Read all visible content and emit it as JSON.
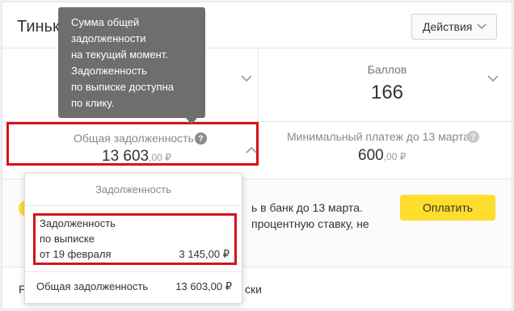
{
  "header": {
    "title": "Тинькофф Платинум",
    "actions_label": "Действия"
  },
  "points": {
    "label": "Баллов",
    "value": "166"
  },
  "debt": {
    "label": "Общая задолженность",
    "value_main": "13 603",
    "value_minor": ",00 ₽"
  },
  "min_payment": {
    "label": "Минимальный платеж до 13 марта",
    "value_main": "600",
    "value_minor": ",00 ₽"
  },
  "notice": {
    "line1": "ь в банк до 13 марта.",
    "line2": "процентную ставку, не"
  },
  "pay_button": "Оплатить",
  "bottom_row": {
    "left_fragment": "Р",
    "right_fragment": "ски"
  },
  "dropdown": {
    "title": "Задолженность",
    "statement_line1": "Задолженность",
    "statement_line2": "по выписке",
    "statement_line3": "от 19 февраля",
    "statement_amount": "3 145,00 ₽",
    "total_label": "Общая задолженность",
    "total_amount": "13 603,00 ₽"
  },
  "tooltip": {
    "lines": [
      "Сумма общей",
      "задолженности",
      "на текущий момент.",
      "Задолженность",
      "по выписке доступна",
      "по клику."
    ]
  },
  "icons": {
    "help": "question-circle-icon",
    "chevron": "chevron-down-icon"
  },
  "colors": {
    "accent_yellow": "#ffdd2d",
    "highlight_red": "#d2141a",
    "tooltip_bg": "#6e6e6e"
  }
}
